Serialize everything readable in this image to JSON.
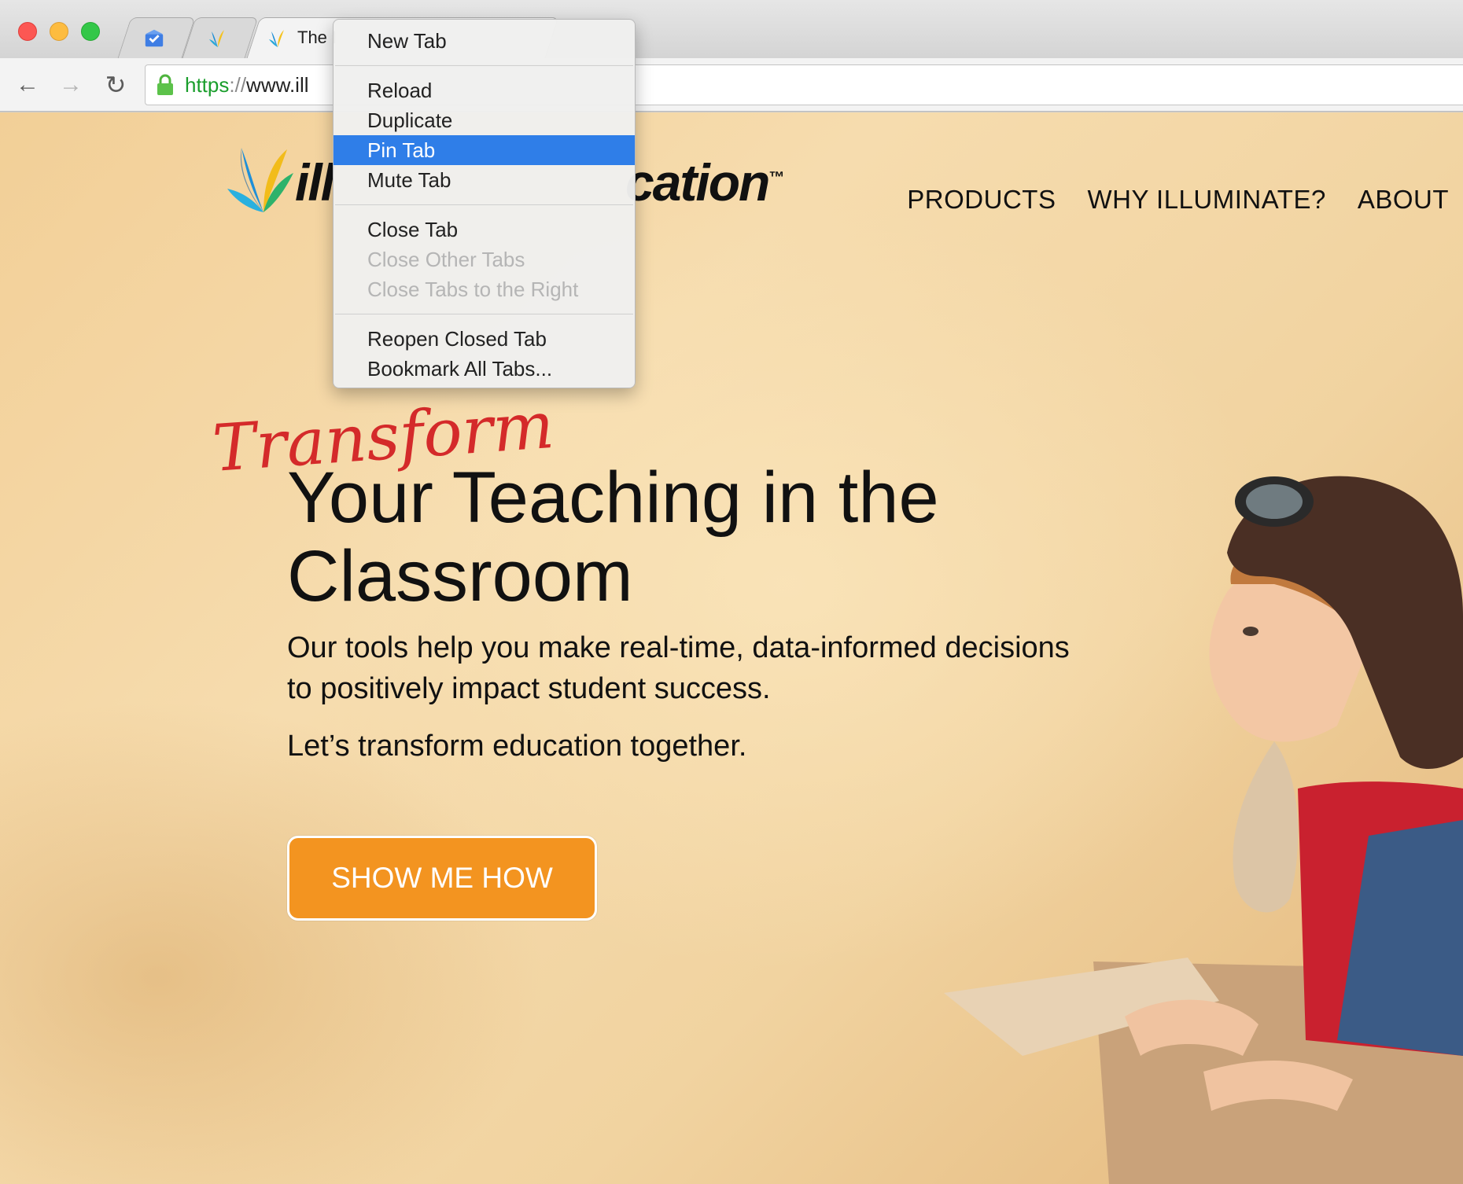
{
  "browser": {
    "tabs": [
      {
        "title": "",
        "icon": "inbox-icon"
      },
      {
        "title": "",
        "icon": "illuminate-favicon-icon"
      },
      {
        "title": "The I",
        "icon": "illuminate-favicon-icon",
        "active": true
      }
    ],
    "url": {
      "scheme": "https",
      "separator": "://",
      "rest": "www.ill"
    }
  },
  "context_menu": {
    "groups": [
      [
        {
          "label": "New Tab",
          "enabled": true
        }
      ],
      [
        {
          "label": "Reload",
          "enabled": true
        },
        {
          "label": "Duplicate",
          "enabled": true
        },
        {
          "label": "Pin Tab",
          "enabled": true,
          "highlighted": true
        },
        {
          "label": "Mute Tab",
          "enabled": true
        }
      ],
      [
        {
          "label": "Close Tab",
          "enabled": true
        },
        {
          "label": "Close Other Tabs",
          "enabled": false
        },
        {
          "label": "Close Tabs to the Right",
          "enabled": false
        }
      ],
      [
        {
          "label": "Reopen Closed Tab",
          "enabled": true
        },
        {
          "label": "Bookmark All Tabs...",
          "enabled": true
        }
      ]
    ]
  },
  "site": {
    "logo": {
      "part1": "ill",
      "part2": "cation",
      "tm": "™"
    },
    "nav": [
      "PRODUCTS",
      "WHY ILLUMINATE?",
      "ABOUT"
    ],
    "hero": {
      "script_word": "Transform",
      "title": "Your Teaching in the Classroom",
      "text1": "Our tools help you make real-time, data-informed decisions to positively impact student success.",
      "text2": "Let’s transform education together.",
      "cta": "SHOW ME HOW"
    }
  },
  "colors": {
    "cta": "#f39420",
    "menu_highlight": "#2f7ee8",
    "script_red": "#d42a2a"
  }
}
